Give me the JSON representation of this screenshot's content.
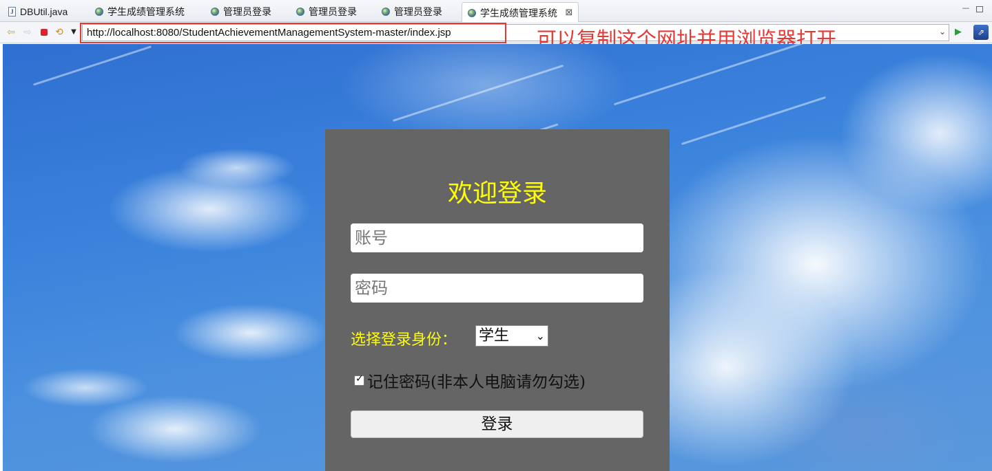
{
  "tabs": [
    {
      "label": "DBUtil.java",
      "icon": "java-file-icon",
      "active": false
    },
    {
      "label": "学生成绩管理系统",
      "icon": "globe-icon",
      "active": false
    },
    {
      "label": "管理员登录",
      "icon": "globe-icon",
      "active": false
    },
    {
      "label": "管理员登录",
      "icon": "globe-icon",
      "active": false
    },
    {
      "label": "管理员登录",
      "icon": "globe-icon",
      "active": false
    },
    {
      "label": "学生成绩管理系统",
      "icon": "globe-icon",
      "active": true,
      "close": "⊠"
    }
  ],
  "toolbar": {
    "url": "http://localhost:8080/StudentAchievementManagementSystem-master/index.jsp",
    "annotation": "可以复制这个网址并用浏览器打开",
    "annotation_color": "#e53935"
  },
  "login": {
    "title": "欢迎登录",
    "account_placeholder": "账号",
    "password_placeholder": "密码",
    "role_label": "选择登录身份：",
    "role_value": "学生",
    "remember_label": "记住密码(非本人电脑请勿勾选)",
    "remember_checked": true,
    "submit_label": "登录",
    "title_color": "#ffff00",
    "panel_color": "#656565"
  }
}
